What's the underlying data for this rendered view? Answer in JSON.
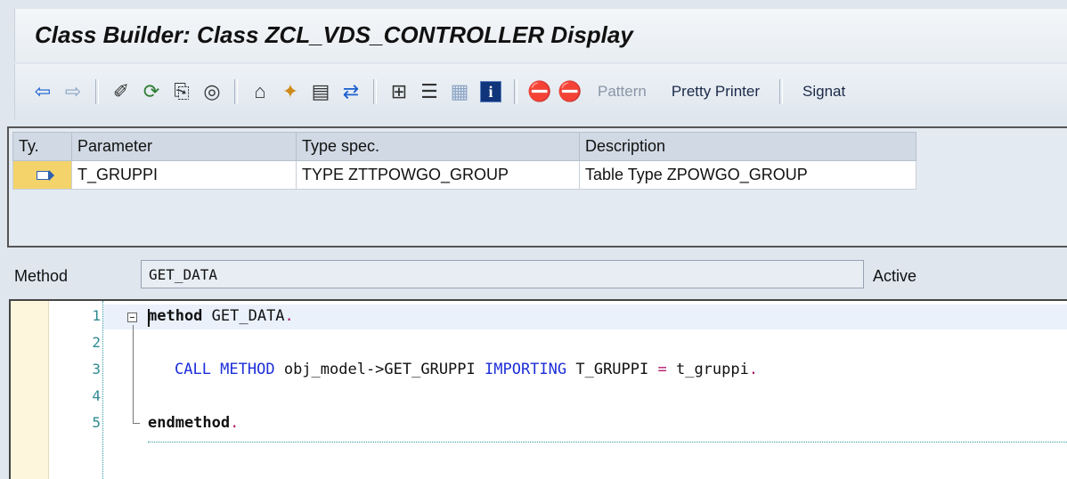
{
  "window": {
    "title": "Class Builder: Class ZCL_VDS_CONTROLLER Display"
  },
  "toolbar": {
    "icons": [
      "back-arrow-icon",
      "forward-arrow-icon",
      "display-change-icon",
      "other-object-icon",
      "check-icon",
      "activate-icon",
      "where-used-icon",
      "navigate-icon",
      "object-list-icon",
      "transport-icon",
      "hierarchy-icon",
      "overview-icon",
      "list-icon",
      "info-icon",
      "breakpoint-icon",
      "external-breakpoint-icon"
    ],
    "pattern_label": "Pattern",
    "pretty_printer_label": "Pretty Printer",
    "signature_label": "Signat"
  },
  "params_table": {
    "headers": [
      "Ty.",
      "Parameter",
      "Type spec.",
      "Description"
    ],
    "rows": [
      {
        "type_marker": "importing-icon",
        "parameter": "T_GRUPPI",
        "type_spec": "TYPE ZTTPOWGO_GROUP",
        "description": "Table Type ZPOWGO_GROUP"
      }
    ]
  },
  "method_bar": {
    "label": "Method",
    "value": "GET_DATA",
    "status": "Active"
  },
  "editor": {
    "line_numbers": [
      "1",
      "2",
      "3",
      "4",
      "5"
    ],
    "lines": {
      "l1_kw": "method",
      "l1_rest": " GET_DATA",
      "l1_dot": ".",
      "l3_kw1": "CALL METHOD",
      "l3_mid": " obj_model->GET_GRUPPI ",
      "l3_kw2": "IMPORTING",
      "l3_t": " T_GRUPPI ",
      "l3_eq": "=",
      "l3_end": " t_gruppi",
      "l3_dot": ".",
      "l5_kw": "endmethod",
      "l5_dot": "."
    }
  },
  "colors": {
    "keyword_blue": "#1c2fd8",
    "dot_pink": "#b0186a",
    "line_number_teal": "#2e8a90",
    "row_marker_yellow": "#f3d36a"
  }
}
